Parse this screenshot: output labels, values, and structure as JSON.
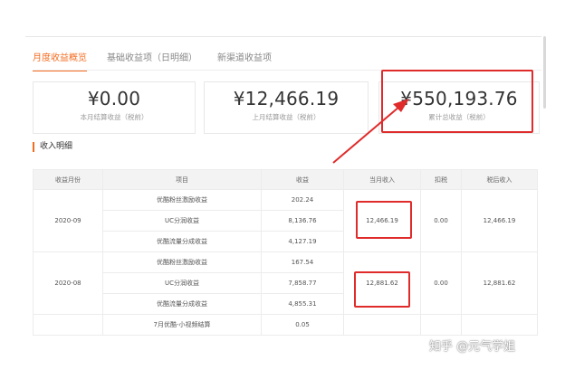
{
  "tabs": [
    {
      "label": "月度收益概览"
    },
    {
      "label": "基础收益项（日明细）"
    },
    {
      "label": "新渠道收益项"
    }
  ],
  "summary": [
    {
      "amount": "¥0.00",
      "label": "本月结算收益（税前）"
    },
    {
      "amount": "¥12,466.19",
      "label": "上月结算收益（税前）"
    },
    {
      "amount": "¥550,193.76",
      "label": "累计总收益（税前）"
    }
  ],
  "section_title": "收入明细",
  "table": {
    "headers": [
      "收益月份",
      "项目",
      "收益",
      "当月收入",
      "扣税",
      "税后收入"
    ],
    "groups": [
      {
        "month": "2020-09",
        "items": [
          {
            "name": "优酷粉丝激励收益",
            "income": "202.24"
          },
          {
            "name": "UC分润收益",
            "income": "8,136.76"
          },
          {
            "name": "优酷流量分成收益",
            "income": "4,127.19"
          }
        ],
        "monthly": "12,466.19",
        "tax": "0.00",
        "after_tax": "12,466.19"
      },
      {
        "month": "2020-08",
        "items": [
          {
            "name": "优酷粉丝激励收益",
            "income": "167.54"
          },
          {
            "name": "UC分润收益",
            "income": "7,858.77"
          },
          {
            "name": "优酷流量分成收益",
            "income": "4,855.31"
          }
        ],
        "monthly": "12,881.62",
        "tax": "0.00",
        "after_tax": "12,881.62"
      }
    ],
    "extra_row": {
      "name": "7月优酷-小视频结算",
      "income": "0.05"
    }
  },
  "watermark": "知乎 @元气学姐",
  "colors": {
    "accent": "#f36c21",
    "highlight": "#e02b2b"
  }
}
